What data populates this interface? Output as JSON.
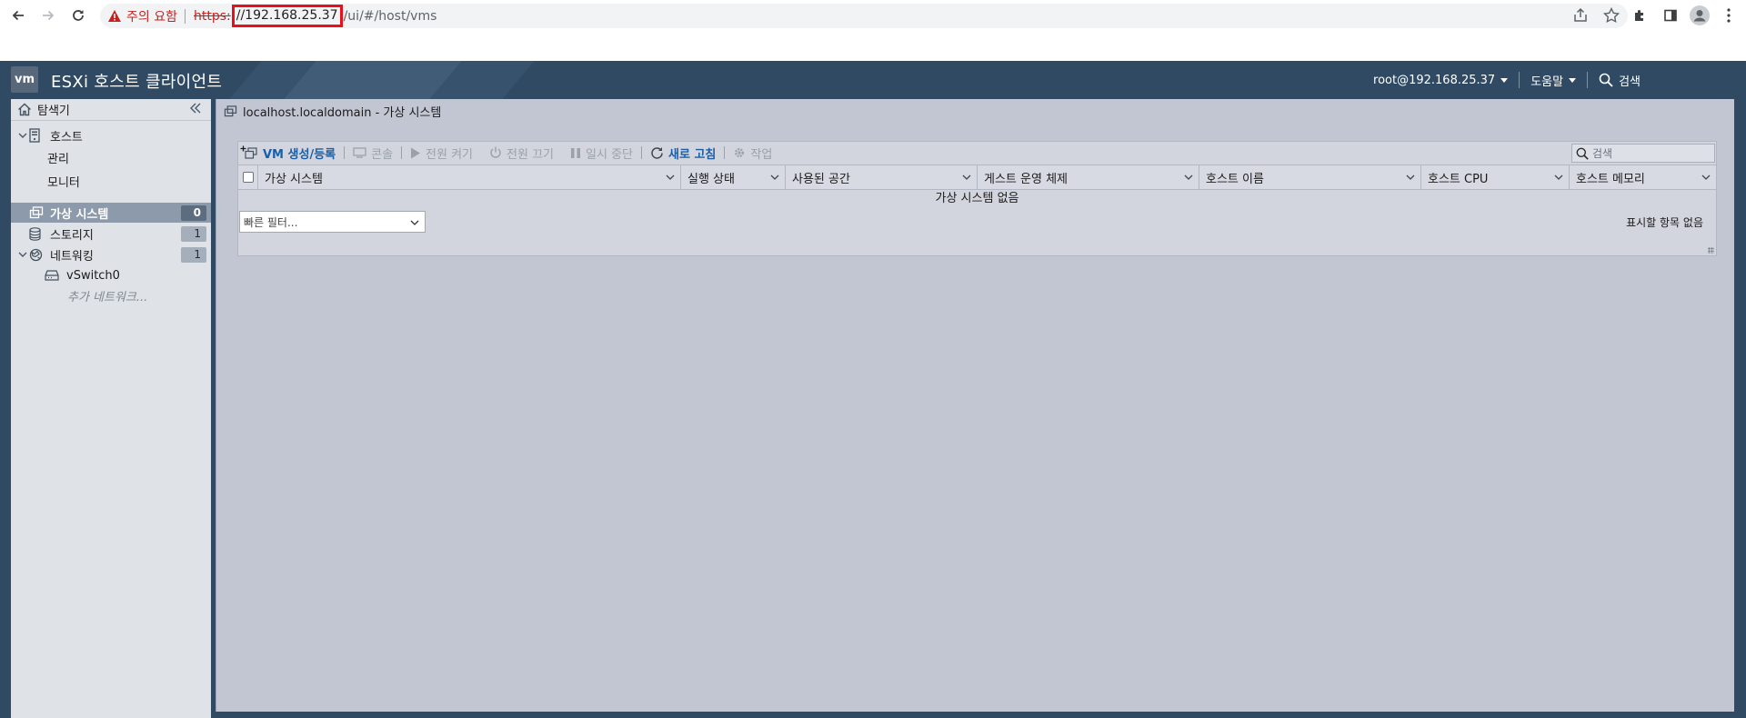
{
  "browser": {
    "security_warning": "주의 요함",
    "url_scheme": "https:",
    "url_host": "//192.168.25.37",
    "url_path": "/ui/#/host/vms"
  },
  "header": {
    "logo": "vm",
    "title": "ESXi 호스트 클라이언트",
    "user": "root@192.168.25.37",
    "help": "도움말",
    "search": "검색"
  },
  "navigator": {
    "title": "탐색기",
    "host_label": "호스트",
    "host_children": [
      "관리",
      "모니터"
    ],
    "vms_label": "가상 시스템",
    "vms_count": "0",
    "storage_label": "스토리지",
    "storage_count": "1",
    "network_label": "네트워킹",
    "network_count": "1",
    "vswitch_label": "vSwitch0",
    "more_networks": "추가 네트워크..."
  },
  "main": {
    "breadcrumb": "localhost.localdomain - 가상 시스템",
    "toolbar": {
      "create": "VM 생성/등록",
      "console": "콘솔",
      "power_on": "전원 켜기",
      "power_off": "전원 끄기",
      "suspend": "일시 중단",
      "refresh": "새로 고침",
      "actions": "작업"
    },
    "search_placeholder": "검색",
    "columns": [
      "가상 시스템",
      "실행 상태",
      "사용된 공간",
      "게스트 운영 체제",
      "호스트 이름",
      "호스트 CPU",
      "호스트 메모리"
    ],
    "empty_message": "가상 시스템 없음",
    "quick_filter": "빠른 필터...",
    "no_items": "표시할 항목 없음"
  },
  "colors": {
    "header_bg": "#2f4a62",
    "nav_active": "#8c9aab",
    "link_blue": "#1a5fa6",
    "warning_red": "#c5221f"
  }
}
